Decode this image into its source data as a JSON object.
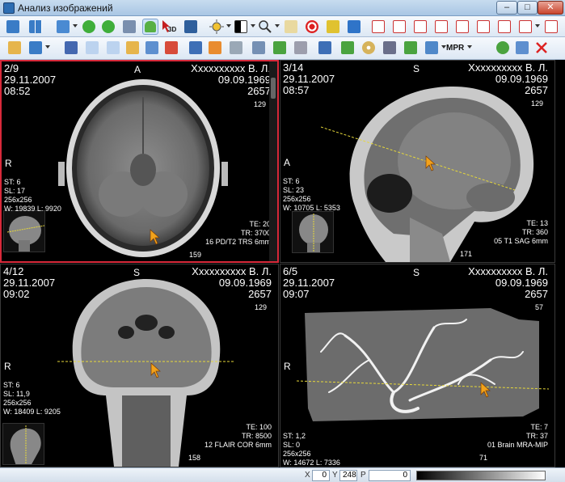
{
  "window": {
    "title": "Анализ изображений",
    "minimize": "–",
    "maximize": "□",
    "close": "✕"
  },
  "toolbar": {
    "tool_3d": "3D",
    "tool_mpr": "MPR"
  },
  "panes": [
    {
      "index": "2/9",
      "date": "29.11.2007",
      "time": "08:52",
      "patient": "Xxxxxxxxxx В. Л.",
      "birth": "09.09.1969",
      "id": "2657",
      "top_dir": "A",
      "left_dir": "R",
      "scale_top": "129",
      "scale_bottom": "159",
      "st": "ST: 6",
      "sl": "SL: 17",
      "matrix": "256x256",
      "wl": "W: 19839 L: 9920",
      "te": "TE: 20",
      "tr": "TR: 3700",
      "series": "16 PD/T2 TRS 6mm"
    },
    {
      "index": "3/14",
      "date": "29.11.2007",
      "time": "08:57",
      "patient": "Xxxxxxxxxx В. Л.",
      "birth": "09.09.1969",
      "id": "2657",
      "top_dir": "S",
      "left_dir": "A",
      "scale_top": "129",
      "scale_bottom": "171",
      "st": "ST: 6",
      "sl": "SL: 23",
      "matrix": "256x256",
      "wl": "W: 10705 L: 5353",
      "te": "TE: 13",
      "tr": "TR: 360",
      "series": "05 T1 SAG 6mm"
    },
    {
      "index": "4/12",
      "date": "29.11.2007",
      "time": "09:02",
      "patient": "Xxxxxxxxxx В. Л.",
      "birth": "09.09.1969",
      "id": "2657",
      "top_dir": "S",
      "left_dir": "R",
      "scale_top": "129",
      "scale_bottom": "158",
      "st": "ST: 6",
      "sl": "SL: 11,9",
      "matrix": "256x256",
      "wl": "W: 18409 L: 9205",
      "te": "TE: 100",
      "tr": "TR: 8500",
      "series": "12 FLAIR COR 6mm"
    },
    {
      "index": "6/5",
      "date": "29.11.2007",
      "time": "09:07",
      "patient": "Xxxxxxxxxx В. Л.",
      "birth": "09.09.1969",
      "id": "2657",
      "top_dir": "S",
      "left_dir": "R",
      "scale_top": "57",
      "scale_bottom": "71",
      "st": "ST: 1,2",
      "sl": "SL: 0",
      "matrix": "256x256",
      "wl": "W: 14672 L: 7336",
      "te": "TE: 7",
      "tr": "TR: 37",
      "series": "01 Brain MRA-MIP"
    }
  ],
  "statusbar": {
    "x_label": "X",
    "x_value": "0",
    "y_label": "Y",
    "y_value": "248",
    "p_label": "P",
    "p_value": "0"
  },
  "colors": {
    "accent": "#d8293a",
    "guideline": "#e6d83a",
    "cursor": "#f2a21b"
  }
}
